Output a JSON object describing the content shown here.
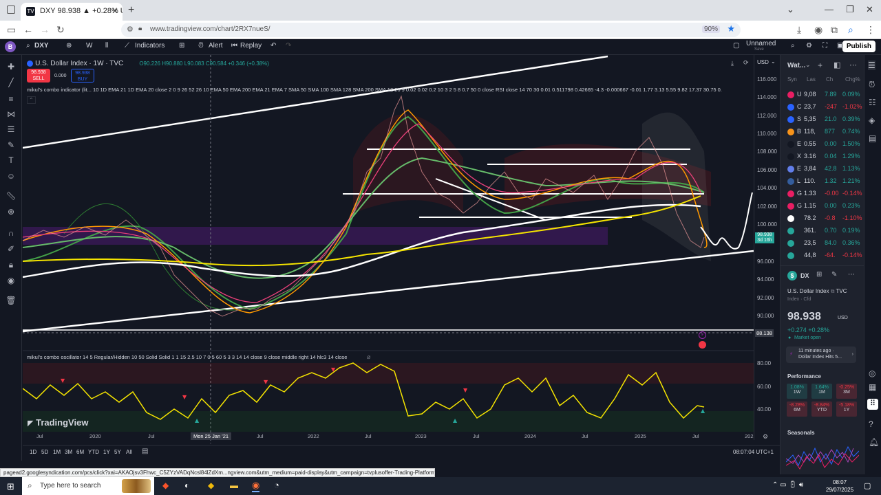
{
  "browser": {
    "tab_title": "DXY 98.938 ▲ +0.28% Unname",
    "url": "www.tradingview.com/chart/2RX7nueS/",
    "zoom": "90%"
  },
  "toolbar": {
    "symbol": "DXY",
    "interval": "W",
    "indicators": "Indicators",
    "alert": "Alert",
    "replay": "Replay",
    "layout_name": "Unnamed",
    "layout_sub": "Save",
    "publish": "Publish"
  },
  "legend": {
    "title": "U.S. Dollar Index · 1W · TVC",
    "ohlc": "O90.226 H90.880 L90.083 C90.584 +0.346 (+0.38%)",
    "sell_price": "98.938",
    "sell": "SELL",
    "spread": "0.000",
    "buy_price": "98.938",
    "buy": "BUY",
    "indicator1": "mikul's combo indicator (lit... 10 1D EMA 21 1D EMA 20 close 2 0 9 26 52 26 10 EMA 50 EMA 200 EMA 21 EMA 7 SMA 50 SMA 100 SMA 128 SMA 200 SMA 12 26 9 0.02 0.02 0.2 10 3 2 5 8 0.7 50 0 close RSI close 14 70 30 0.01 0.511798 0.42665 -4.3 -0.000667 -0.01 1.77 3.13 5.55 9.82 17.37 30.75 0.",
    "indicator2": "mikul's combo oscillator 14 5 Regular/Hidden 10 50 Solid Solid 1 1 15 2.5 10 7 0 5 60 5 3 3 14 14 close 9 close middle right 14 hlc3 14 close"
  },
  "price_axis": {
    "currency": "USD",
    "labels": [
      "116.000",
      "114.000",
      "112.000",
      "110.000",
      "108.000",
      "106.000",
      "104.000",
      "102.000",
      "100.000",
      "98.000",
      "96.000",
      "94.000",
      "92.000",
      "90.000"
    ],
    "current_price": "98.938",
    "countdown": "3d 16h",
    "crosshair_price": "88.138",
    "osc_labels": [
      "80.00",
      "60.00",
      "40.00"
    ]
  },
  "time_axis": {
    "labels": [
      "Jul",
      "2020",
      "Jul",
      "Mon 25 Jan '21",
      "Jul",
      "2022",
      "Jul",
      "2023",
      "Jul",
      "2024",
      "Jul",
      "2025",
      "Jul",
      "202"
    ]
  },
  "bottom": {
    "ranges": [
      "1D",
      "5D",
      "1M",
      "3M",
      "6M",
      "YTD",
      "1Y",
      "5Y",
      "All"
    ],
    "clock": "08:07:04 UTC+1",
    "logo": "TradingView"
  },
  "watchlist": {
    "title": "Wat...",
    "headers": [
      "Syn",
      "Las",
      "Ch",
      "Chg%"
    ],
    "rows": [
      {
        "sym": "U",
        "last": "9,08",
        "chg": "7.89",
        "pct": "0.09%",
        "dir": "up",
        "color": "#e91e63"
      },
      {
        "sym": "C",
        "last": "23,7",
        "chg": "-247",
        "pct": "-1.02%",
        "dir": "down",
        "color": "#2962ff"
      },
      {
        "sym": "S",
        "last": "5,35",
        "chg": "21.0",
        "pct": "0.39%",
        "dir": "up",
        "color": "#2962ff"
      },
      {
        "sym": "B",
        "last": "118,",
        "chg": "877",
        "pct": "0.74%",
        "dir": "up",
        "color": "#f7931a"
      },
      {
        "sym": "E",
        "last": "0.55",
        "chg": "0.00",
        "pct": "1.50%",
        "dir": "up",
        "color": "#131722"
      },
      {
        "sym": "X",
        "last": "3.16",
        "chg": "0.04",
        "pct": "1.29%",
        "dir": "up",
        "color": "#131722"
      },
      {
        "sym": "E",
        "last": "3,84",
        "chg": "42.8",
        "pct": "1.13%",
        "dir": "up",
        "color": "#627eea"
      },
      {
        "sym": "L",
        "last": "110.",
        "chg": "1.32",
        "pct": "1.21%",
        "dir": "up",
        "color": "#345d9d"
      },
      {
        "sym": "G",
        "last": "1.33",
        "chg": "-0.00",
        "pct": "-0.14%",
        "dir": "down",
        "color": "#e91e63"
      },
      {
        "sym": "G",
        "last": "1.15",
        "chg": "0.00",
        "pct": "0.23%",
        "dir": "up",
        "color": "#e91e63"
      },
      {
        "sym": "",
        "last": "78.2",
        "chg": "-0.8",
        "pct": "-1.10%",
        "dir": "down",
        "color": "#ffffff"
      },
      {
        "sym": "",
        "last": "361.",
        "chg": "0.70",
        "pct": "0.19%",
        "dir": "up",
        "color": "#26a69a"
      },
      {
        "sym": "",
        "last": "23,5",
        "chg": "84.0",
        "pct": "0.36%",
        "dir": "up",
        "color": "#26a69a"
      },
      {
        "sym": "",
        "last": "44,8",
        "chg": "-64.",
        "pct": "-0.14%",
        "dir": "down",
        "color": "#26a69a"
      }
    ]
  },
  "details": {
    "symbol": "DX",
    "name": "U.S. Dollar Index",
    "exchange": "TVC",
    "type": "Index · Cfd",
    "price": "98.938",
    "currency": "USD",
    "change": "+0.274  +0.28%",
    "market": "Market open",
    "news_time": "11 minutes ago ·",
    "news_title": "Dollar Index Hits 5...",
    "performance": "Performance",
    "perf": [
      {
        "v": "1.08%",
        "p": "1W",
        "dir": "up"
      },
      {
        "v": "1.64%",
        "p": "1M",
        "dir": "up"
      },
      {
        "v": "-0.25%",
        "p": "3M",
        "dir": "down"
      },
      {
        "v": "-8.28%",
        "p": "6M",
        "dir": "down"
      },
      {
        "v": "-8.84%",
        "p": "YTD",
        "dir": "down"
      },
      {
        "v": "-5.18%",
        "p": "1Y",
        "dir": "down"
      }
    ],
    "seasonals": "Seasonals"
  },
  "status_url": "pagead2.googlesyndication.com/pcs/click?xai=AKAOjsv3Fhwc_C5ZYzVADqNcsl84lZdXm...ngview.com&utm_medium=paid-display&utm_campaign=tvplusoffer-Trading-Platform",
  "taskbar": {
    "search_placeholder": "Type here to search",
    "time": "08:07",
    "date": "29/07/2025"
  },
  "colors": {
    "up": "#26a69a",
    "down": "#f23645",
    "accent": "#2962ff",
    "yellow": "#f5e400"
  }
}
